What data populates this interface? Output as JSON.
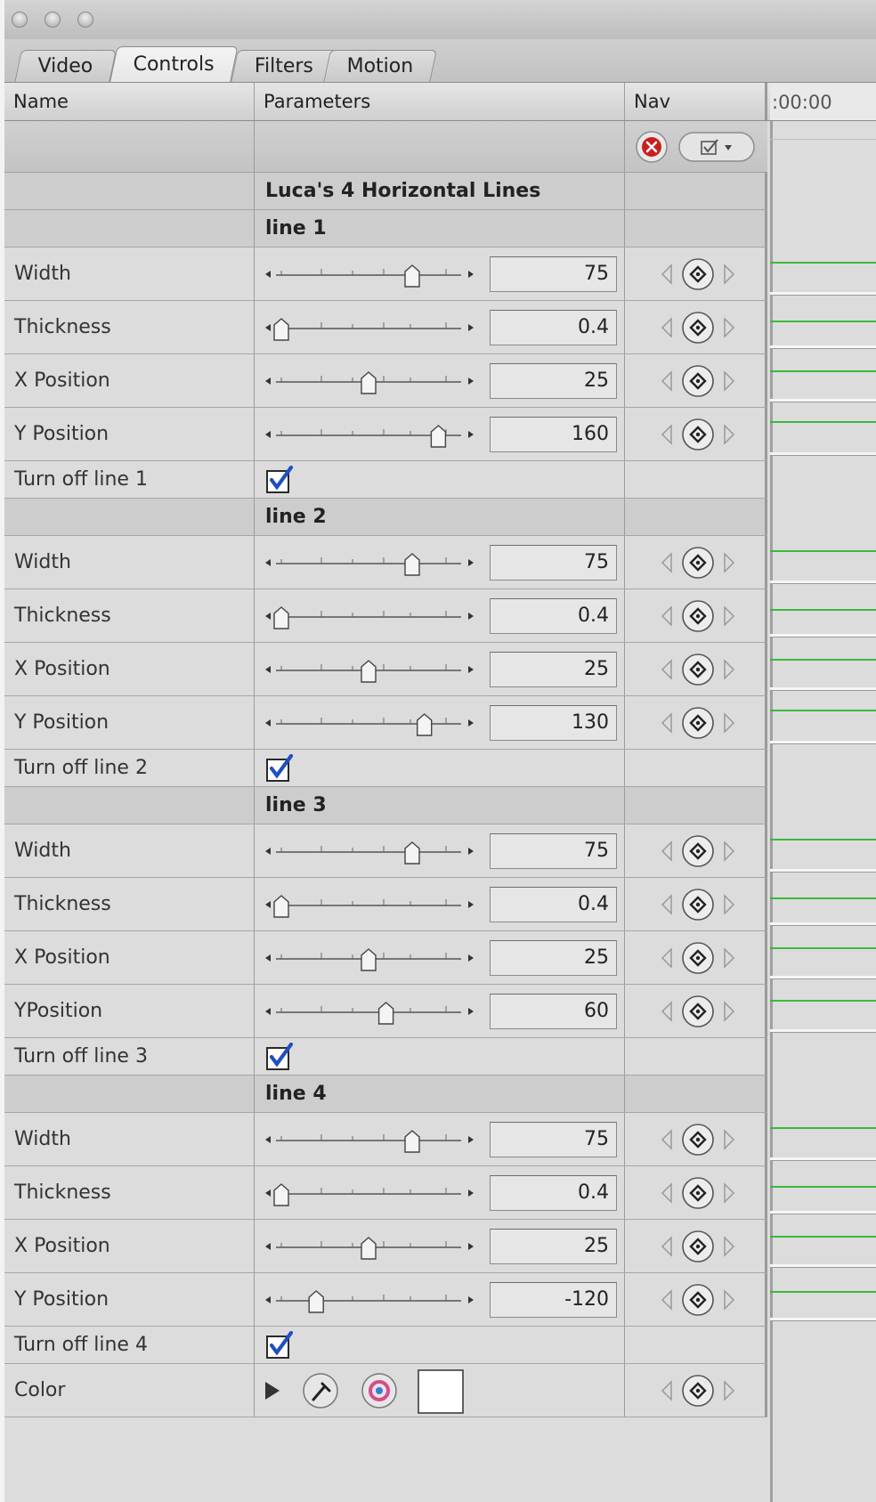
{
  "tabs": [
    {
      "label": "Video",
      "active": false
    },
    {
      "label": "Controls",
      "active": true
    },
    {
      "label": "Filters",
      "active": false
    },
    {
      "label": "Motion",
      "active": false
    }
  ],
  "header": {
    "name": "Name",
    "parameters": "Parameters",
    "nav": "Nav",
    "timecode": ":00:00"
  },
  "filter_title": "Luca's 4 Horizontal Lines",
  "groups": [
    {
      "label": "line 1",
      "params": [
        {
          "name": "Width",
          "value": "75",
          "slider": 0.75
        },
        {
          "name": "Thickness",
          "value": "0.4",
          "slider": 0.0
        },
        {
          "name": "X Position",
          "value": "25",
          "slider": 0.5
        },
        {
          "name": "Y Position",
          "value": "160",
          "slider": 0.9
        }
      ],
      "toggle": {
        "label": "Turn off line 1",
        "checked": true
      }
    },
    {
      "label": "line 2",
      "params": [
        {
          "name": "Width",
          "value": "75",
          "slider": 0.75
        },
        {
          "name": "Thickness",
          "value": "0.4",
          "slider": 0.0
        },
        {
          "name": "X Position",
          "value": "25",
          "slider": 0.5
        },
        {
          "name": "Y Position",
          "value": "130",
          "slider": 0.82
        }
      ],
      "toggle": {
        "label": "Turn off line 2",
        "checked": true
      }
    },
    {
      "label": "line 3",
      "params": [
        {
          "name": "Width",
          "value": "75",
          "slider": 0.75
        },
        {
          "name": "Thickness",
          "value": "0.4",
          "slider": 0.0
        },
        {
          "name": "X Position",
          "value": "25",
          "slider": 0.5
        },
        {
          "name": "YPosition",
          "value": "60",
          "slider": 0.6
        }
      ],
      "toggle": {
        "label": "Turn off line 3",
        "checked": true
      }
    },
    {
      "label": "line 4",
      "params": [
        {
          "name": "Width",
          "value": "75",
          "slider": 0.75
        },
        {
          "name": "Thickness",
          "value": "0.4",
          "slider": 0.0
        },
        {
          "name": "X Position",
          "value": "25",
          "slider": 0.5
        },
        {
          "name": "Y Position",
          "value": "-120",
          "slider": 0.2
        }
      ],
      "toggle": {
        "label": "Turn off line 4",
        "checked": true
      }
    }
  ],
  "color": {
    "label": "Color",
    "swatch": "#ffffff"
  },
  "colors": {
    "keyframe_green": "#3cb83c",
    "panel": "#dcdcdc",
    "checkbox_blue": "#1f4fbf"
  }
}
